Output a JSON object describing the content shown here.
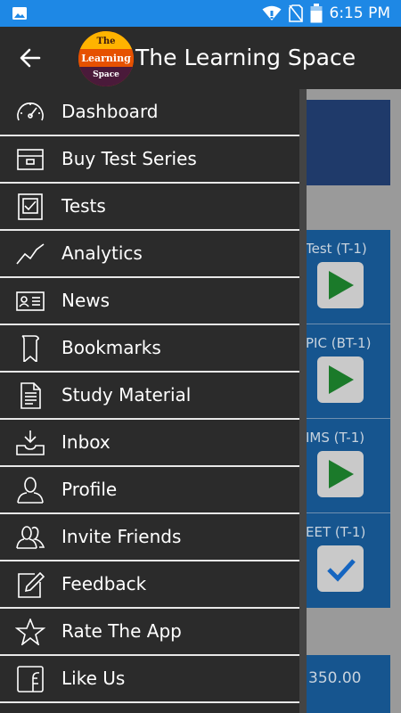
{
  "status_bar": {
    "time": "6:15 PM",
    "icons": [
      "image-icon",
      "wifi-icon",
      "sim-icon",
      "battery-icon"
    ],
    "color": "#1e88e5"
  },
  "header": {
    "title": "The Learning Space",
    "logo": {
      "line1": "The",
      "line2": "Learning",
      "line3": "Space"
    }
  },
  "menu": {
    "items": [
      {
        "label": "Dashboard",
        "icon": "speedometer-icon"
      },
      {
        "label": "Buy Test Series",
        "icon": "box-icon"
      },
      {
        "label": "Tests",
        "icon": "checklist-icon"
      },
      {
        "label": "Analytics",
        "icon": "trend-chart-icon"
      },
      {
        "label": "News",
        "icon": "id-card-icon"
      },
      {
        "label": "Bookmarks",
        "icon": "bookmark-icon"
      },
      {
        "label": "Study Material",
        "icon": "document-icon"
      },
      {
        "label": "Inbox",
        "icon": "inbox-icon"
      },
      {
        "label": "Profile",
        "icon": "person-icon"
      },
      {
        "label": "Invite Friends",
        "icon": "people-icon"
      },
      {
        "label": "Feedback",
        "icon": "edit-icon"
      },
      {
        "label": "Rate The App",
        "icon": "star-icon"
      },
      {
        "label": "Like Us",
        "icon": "facebook-icon"
      }
    ]
  },
  "background": {
    "rows": [
      {
        "title": "Test (T-1)",
        "action": "play"
      },
      {
        "title": "PIC (BT-1)",
        "action": "play"
      },
      {
        "title": "IMS (T-1)",
        "action": "play"
      },
      {
        "title": "EET (T-1)",
        "action": "done"
      }
    ],
    "price": "350.00"
  }
}
